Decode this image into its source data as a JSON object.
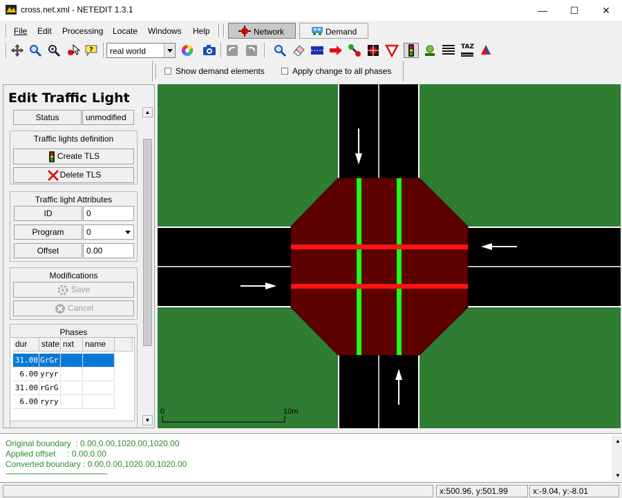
{
  "window": {
    "title": "cross.net.xml - NETEDIT 1.3.1",
    "minimize_glyph": "—",
    "maximize_glyph": "☐",
    "close_glyph": "✕"
  },
  "menu": {
    "items": [
      {
        "label": "File"
      },
      {
        "label": "Edit"
      },
      {
        "label": "Processing"
      },
      {
        "label": "Locate"
      },
      {
        "label": "Windows"
      },
      {
        "label": "Help"
      }
    ],
    "modes": [
      {
        "label": "Network",
        "icon": "network-mode-icon",
        "active": true
      },
      {
        "label": "Demand",
        "icon": "demand-mode-icon",
        "active": false
      }
    ]
  },
  "toolbar": {
    "view_select_value": "real world",
    "icons": [
      "recenter-icon",
      "locate-icon",
      "locate-junction-icon",
      "pointer-select-icon",
      "tooltip-icon",
      "color-wheel-icon",
      "screenshot-icon",
      "undo-icon",
      "redo-icon",
      "inspect-icon",
      "delete-icon",
      "select-icon",
      "move-icon",
      "create-edge-icon",
      "connection-icon",
      "prohibition-icon",
      "traffic-light-icon",
      "additional-icon",
      "crossing-icon",
      "taz-icon",
      "polygon-icon"
    ],
    "taz_label": "TAZ"
  },
  "options": {
    "show_demand_label": "Show demand elements",
    "apply_change_label": "Apply change to all phases"
  },
  "panel": {
    "title": "Edit Traffic Light",
    "status_label": "Status",
    "status_value": "unmodified",
    "definition_group": "Traffic lights definition",
    "create_tls": "Create TLS",
    "delete_tls": "Delete TLS",
    "attributes_group": "Traffic light Attributes",
    "id_label": "ID",
    "id_value": "0",
    "program_label": "Program",
    "program_value": "0",
    "offset_label": "Offset",
    "offset_value": "0.00",
    "modifications_group": "Modifications",
    "save_label": "Save",
    "cancel_label": "Cancel",
    "phases_group": "Phases",
    "phase_columns": [
      "dur",
      "state",
      "nxt",
      "name"
    ],
    "phases": [
      {
        "dur": "31.00",
        "state": "GrGr",
        "nxt": "",
        "name": ""
      },
      {
        "dur": "6.00",
        "state": "yryr",
        "nxt": "",
        "name": ""
      },
      {
        "dur": "31.00",
        "state": "rGrG",
        "nxt": "",
        "name": ""
      },
      {
        "dur": "6.00",
        "state": "ryry",
        "nxt": "",
        "name": ""
      }
    ],
    "selected_phase": 0
  },
  "map": {
    "scale_start": "0",
    "scale_end": "10m",
    "colors": {
      "grass": "#2e7d32",
      "road": "#000000",
      "junction": "#5c0000",
      "green_light": "#19ff19",
      "red_light": "#ff1414"
    }
  },
  "messages": [
    "Original boundary  : 0.00,0.00,1020.00,1020.00",
    "Applied offset     : 0.00,0.00",
    "Converted boundary : 0.00,0.00,1020.00,1020.00",
    "-------------------------------------------------"
  ],
  "status": {
    "coords1": "x:500.96, y:501.99",
    "coords2": "x:-9.04, y:-8.01"
  }
}
